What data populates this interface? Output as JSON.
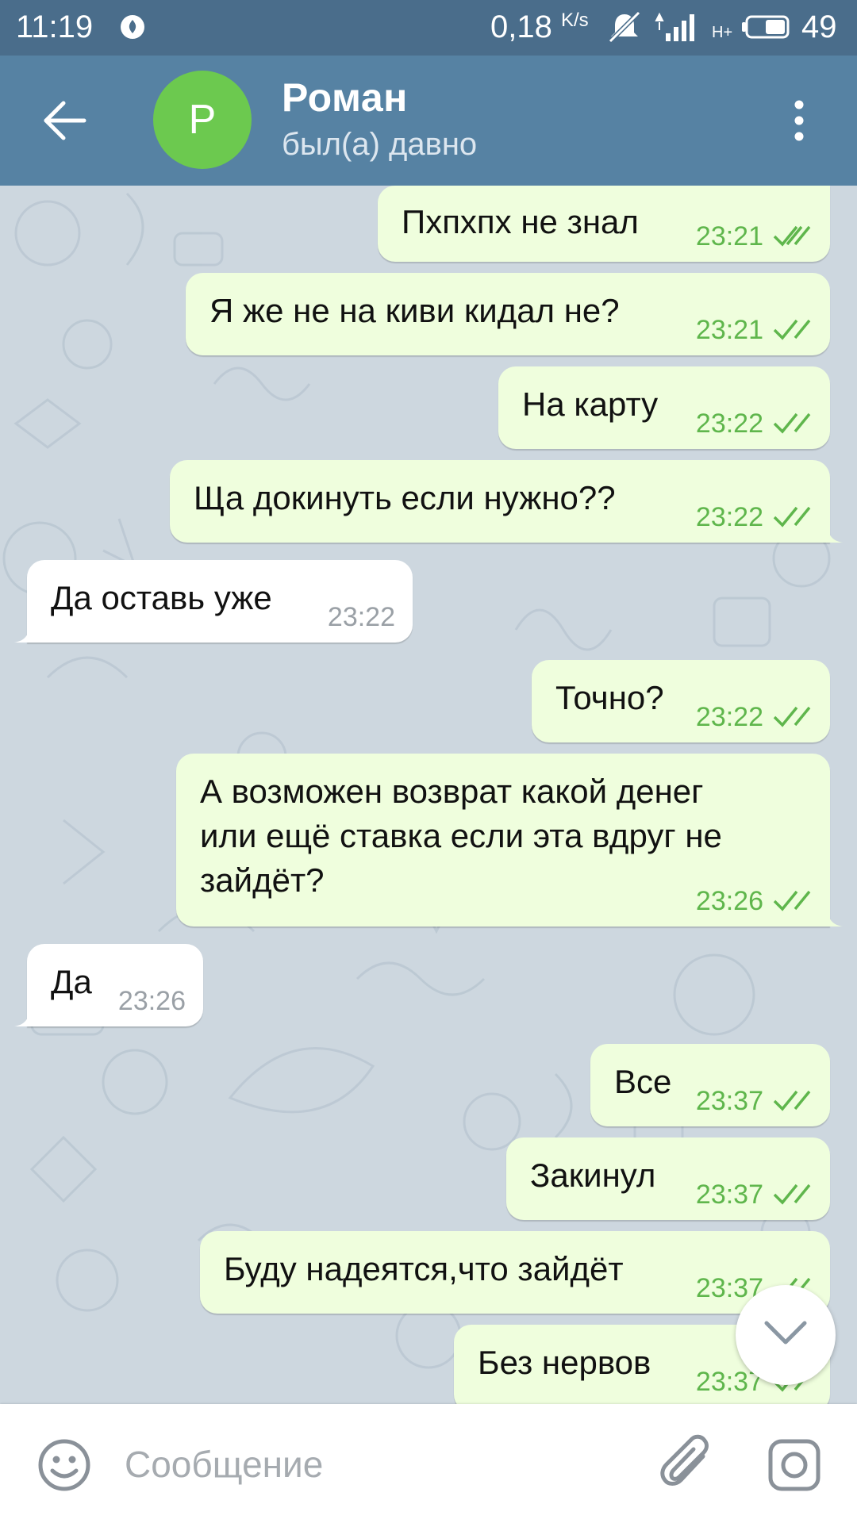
{
  "status_bar": {
    "time": "11:19",
    "speed_value": "0,18",
    "speed_unit": "K/s",
    "network_type": "H+",
    "battery_level": "49"
  },
  "header": {
    "avatar_letter": "Р",
    "contact_name": "Роман",
    "contact_status": "был(а) давно",
    "avatar_color": "#6cc94f",
    "header_color": "#5682a3"
  },
  "messages": [
    {
      "direction": "out",
      "text": "Пхпхпх не знал",
      "time": "23:21",
      "read": true
    },
    {
      "direction": "out",
      "text": "Я же не на киви кидал не?",
      "time": "23:21",
      "read": true
    },
    {
      "direction": "out",
      "text": "На карту",
      "time": "23:22",
      "read": true
    },
    {
      "direction": "out",
      "text": "Ща докинуть если нужно??",
      "time": "23:22",
      "read": true
    },
    {
      "direction": "in",
      "text": "Да оставь уже",
      "time": "23:22"
    },
    {
      "direction": "out",
      "text": "Точно?",
      "time": "23:22",
      "read": true
    },
    {
      "direction": "out",
      "text_lines": [
        "А возможен возврат какой денег",
        "или ещё ставка если эта вдруг не",
        "зайдёт?"
      ],
      "time": "23:26",
      "read": true
    },
    {
      "direction": "in",
      "text": "Да",
      "time": "23:26"
    },
    {
      "direction": "out",
      "text": "Все",
      "time": "23:37",
      "read": true
    },
    {
      "direction": "out",
      "text": "Закинул",
      "time": "23:37",
      "read": true
    },
    {
      "direction": "out",
      "text": "Буду надеятся,что зайдёт",
      "time": "23:37",
      "read": true
    },
    {
      "direction": "out",
      "text": "Без нервов",
      "time": "23:37",
      "read": true
    }
  ],
  "input": {
    "placeholder": "Сообщение"
  },
  "colors": {
    "outgoing_bubble": "#effedd",
    "incoming_bubble": "#ffffff",
    "outgoing_time": "#5fb64c",
    "chat_background": "#cdd7df"
  },
  "icons": {
    "back": "back-arrow-icon",
    "menu": "more-vertical-icon",
    "emoji": "emoji-icon",
    "attach": "paperclip-icon",
    "camera": "camera-icon",
    "scroll_down": "chevron-down-icon",
    "read_receipt": "double-check-icon"
  }
}
